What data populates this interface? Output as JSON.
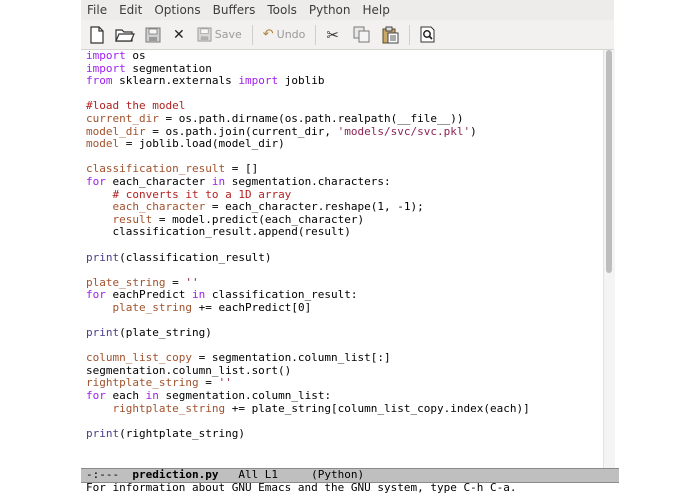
{
  "menu": [
    "File",
    "Edit",
    "Options",
    "Buffers",
    "Tools",
    "Python",
    "Help"
  ],
  "toolbar": {
    "new_icon": "new-file-icon",
    "open_icon": "open-folder-icon",
    "save_icon": "save-disk-icon",
    "close_icon": "close-icon",
    "save_label": "Save",
    "undo_label": "Undo",
    "cut_icon": "scissors-icon",
    "copy_icon": "copy-icon",
    "paste_icon": "paste-icon",
    "search_icon": "search-icon"
  },
  "code": [
    [
      [
        "kw",
        "import"
      ],
      [
        "t",
        " os"
      ]
    ],
    [
      [
        "kw",
        "import"
      ],
      [
        "t",
        " segmentation"
      ]
    ],
    [
      [
        "kw",
        "from"
      ],
      [
        "t",
        " sklearn.externals "
      ],
      [
        "kw",
        "import"
      ],
      [
        "t",
        " joblib"
      ]
    ],
    [],
    [
      [
        "cm",
        "#load the model"
      ]
    ],
    [
      [
        "var",
        "current_dir"
      ],
      [
        "t",
        " = os.path.dirname(os.path.realpath(__file__))"
      ]
    ],
    [
      [
        "var",
        "model_dir"
      ],
      [
        "t",
        " = os.path.join(current_dir, "
      ],
      [
        "str",
        "'models/svc/svc.pkl'"
      ],
      [
        "t",
        ")"
      ]
    ],
    [
      [
        "var",
        "model"
      ],
      [
        "t",
        " = joblib.load(model_dir)"
      ]
    ],
    [],
    [
      [
        "var",
        "classification_result"
      ],
      [
        "t",
        " = []"
      ]
    ],
    [
      [
        "kw",
        "for"
      ],
      [
        "t",
        " each_character "
      ],
      [
        "kw",
        "in"
      ],
      [
        "t",
        " segmentation.characters:"
      ]
    ],
    [
      [
        "t",
        "    "
      ],
      [
        "cm",
        "# converts it to a 1D array"
      ]
    ],
    [
      [
        "t",
        "    "
      ],
      [
        "var",
        "each_character"
      ],
      [
        "t",
        " = each_character.reshape(1, -1);"
      ]
    ],
    [
      [
        "t",
        "    "
      ],
      [
        "var",
        "result"
      ],
      [
        "t",
        " = model.predict(each_character)"
      ]
    ],
    [
      [
        "t",
        "    classification_result.append(result)"
      ]
    ],
    [],
    [
      [
        "bi",
        "print"
      ],
      [
        "t",
        "(classification_result)"
      ]
    ],
    [],
    [
      [
        "var",
        "plate_string"
      ],
      [
        "t",
        " = "
      ],
      [
        "str",
        "''"
      ]
    ],
    [
      [
        "kw",
        "for"
      ],
      [
        "t",
        " eachPredict "
      ],
      [
        "kw",
        "in"
      ],
      [
        "t",
        " classification_result:"
      ]
    ],
    [
      [
        "t",
        "    "
      ],
      [
        "var",
        "plate_string"
      ],
      [
        "t",
        " += eachPredict[0]"
      ]
    ],
    [],
    [
      [
        "bi",
        "print"
      ],
      [
        "t",
        "(plate_string)"
      ]
    ],
    [],
    [
      [
        "var",
        "column_list_copy"
      ],
      [
        "t",
        " = segmentation.column_list[:]"
      ]
    ],
    [
      [
        "t",
        "segmentation.column_list.sort()"
      ]
    ],
    [
      [
        "var",
        "rightplate_string"
      ],
      [
        "t",
        " = "
      ],
      [
        "str",
        "''"
      ]
    ],
    [
      [
        "kw",
        "for"
      ],
      [
        "t",
        " each "
      ],
      [
        "kw",
        "in"
      ],
      [
        "t",
        " segmentation.column_list:"
      ]
    ],
    [
      [
        "t",
        "    "
      ],
      [
        "var",
        "rightplate_string"
      ],
      [
        "t",
        " += plate_string[column_list_copy.index(each)]"
      ]
    ],
    [],
    [
      [
        "bi",
        "print"
      ],
      [
        "t",
        "(rightplate_string)"
      ]
    ]
  ],
  "modeline": {
    "status": "-:---  ",
    "buffer": "prediction.py",
    "position": "   All L1     ",
    "mode": "(Python)"
  },
  "echo_area": "For information about GNU Emacs and the GNU system, type C-h C-a."
}
